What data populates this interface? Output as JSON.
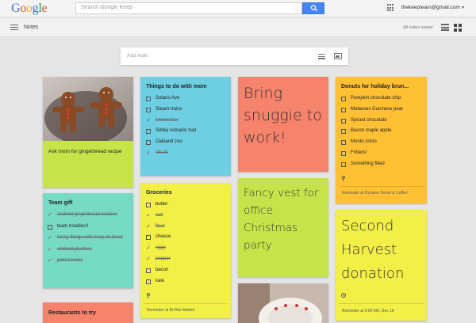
{
  "header": {
    "logo": [
      "G",
      "o",
      "o",
      "g",
      "l",
      "e"
    ],
    "search_placeholder": "Search Google Keep",
    "user": "thekeepteam@gmail.com",
    "user_caret": "▾"
  },
  "subbar": {
    "title": "Notes",
    "status": "All notes saved"
  },
  "add_note": {
    "placeholder": "Add note"
  },
  "notes": {
    "gingerbread": {
      "text": "Ask mom for gingerbread recipe",
      "color": "#c6e34a"
    },
    "things_mom": {
      "title": "Things to do with mom",
      "color": "#6ecfe3",
      "items": [
        {
          "label": "Solano Ave",
          "done": false
        },
        {
          "label": "Steam trains",
          "done": false
        },
        {
          "label": "Moonraker",
          "done": true
        },
        {
          "label": "Sibley volcanic trail",
          "done": false
        },
        {
          "label": "Oakland zoo",
          "done": false
        },
        {
          "label": "4th St",
          "done": true
        }
      ]
    },
    "snuggie": {
      "text": "Bring snuggie to work!",
      "color": "#f6836b"
    },
    "donuts": {
      "title": "Donuts for holiday brun...",
      "color": "#ffc133",
      "items": [
        {
          "label": "Pumpkin chocolate chip",
          "done": false
        },
        {
          "label": "Molasses Guinness pear",
          "done": false
        },
        {
          "label": "Spiced chocolate",
          "done": false
        },
        {
          "label": "Bacon maple apple",
          "done": false
        },
        {
          "label": "Monte cristo",
          "done": false
        },
        {
          "label": "Fritters!",
          "done": false
        },
        {
          "label": "Something filled",
          "done": false
        }
      ],
      "reminder": "Reminder at Dynamo Donut & Coffee"
    },
    "team_gift": {
      "title": "Team gift",
      "color": "#77dbc3",
      "items": [
        {
          "label": "android gingerbread cookies",
          "done": true
        },
        {
          "label": "team hoodies!!",
          "done": false
        },
        {
          "label": "funny things with keep on them",
          "done": true
        },
        {
          "label": "android plushies",
          "done": true
        },
        {
          "label": "post it notes",
          "done": true
        }
      ]
    },
    "groceries": {
      "title": "Groceries",
      "color": "#f2ef46",
      "items": [
        {
          "label": "butter",
          "done": false
        },
        {
          "label": "salt",
          "done": true
        },
        {
          "label": "flour",
          "done": true
        },
        {
          "label": "cheese",
          "done": false
        },
        {
          "label": "eggs",
          "done": true
        },
        {
          "label": "pepper",
          "done": true
        },
        {
          "label": "bacon",
          "done": false
        },
        {
          "label": "kale",
          "done": false
        }
      ],
      "reminder": "Reminder at Bi-Rite Market"
    },
    "fancy_vest": {
      "text": "Fancy vest for office Christmas party",
      "color": "#c6e34a"
    },
    "harvest": {
      "text": "Second Harvest donation",
      "color": "#f2ef46",
      "reminder": "Reminder at 9:00 AM, Dec 18"
    },
    "restaurants": {
      "title": "Restaurants to try",
      "color": "#f6836b"
    }
  },
  "colors": {
    "accent_blue": "#4786f1",
    "background": "#e5e5e5"
  }
}
